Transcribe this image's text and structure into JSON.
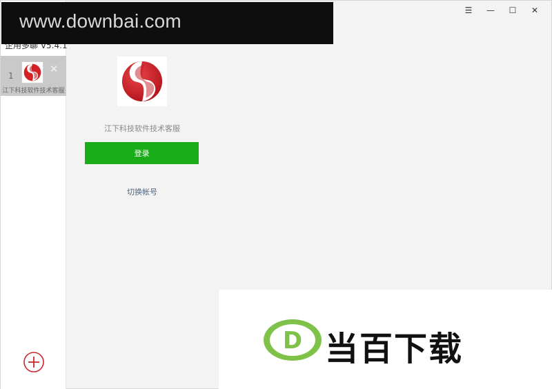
{
  "app": {
    "title": "企用多聊 V5.4.1"
  },
  "window_controls": {
    "menu": "☰",
    "minimize": "—",
    "maximize": "☐",
    "close": "✕"
  },
  "sidebar": {
    "accounts": [
      {
        "index": "1",
        "name": "江下科技软件技术客服",
        "close": "✕"
      }
    ],
    "add_icon": "plus-circle-icon"
  },
  "login": {
    "profile_name": "江下科技软件技术客服",
    "login_button": "登录",
    "switch_account": "切换帐号"
  },
  "watermarks": {
    "url": "www.downbai.com",
    "brand_text": "当百下载",
    "brand_letter": "D"
  },
  "colors": {
    "accent_green": "#1aad19",
    "add_icon_red": "#c8282e",
    "link_blue": "#52657f"
  }
}
